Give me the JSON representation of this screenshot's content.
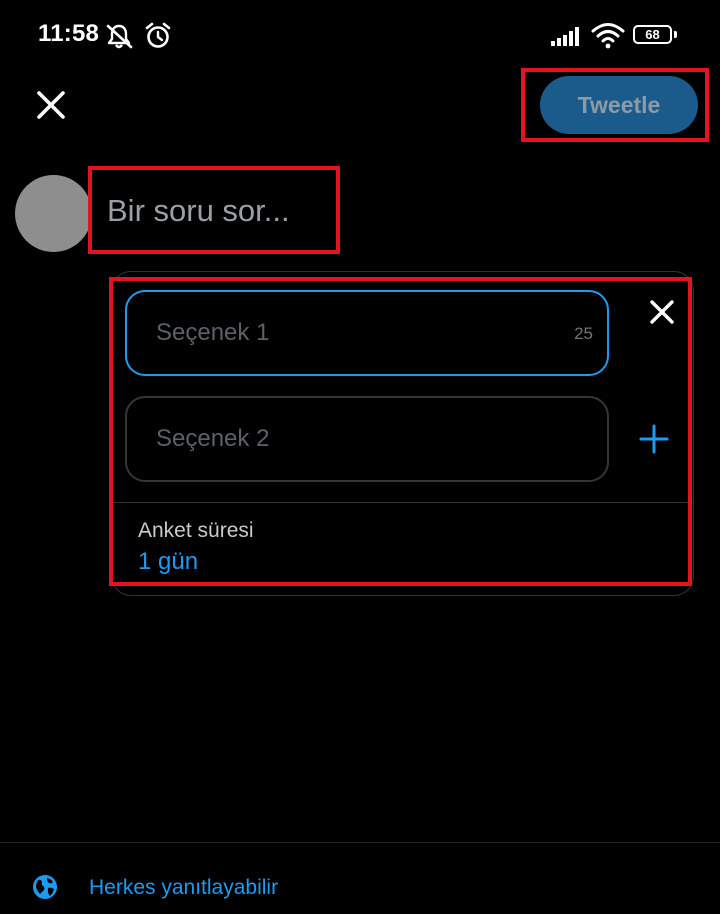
{
  "status_bar": {
    "time": "11:58",
    "battery": "68",
    "icons": [
      "mute-bell-icon",
      "alarm-clock-icon",
      "signal-icon",
      "wifi-icon",
      "battery-icon"
    ]
  },
  "header": {
    "close_icon": "close-icon",
    "tweet_button": "Tweetle"
  },
  "composer": {
    "question_placeholder": "Bir soru sor..."
  },
  "poll": {
    "choices": [
      {
        "placeholder": "Seçenek 1",
        "char_count": "25",
        "focused": true
      },
      {
        "placeholder": "Seçenek 2"
      }
    ],
    "remove_icon": "close-icon",
    "add_icon": "plus-icon",
    "length_label": "Anket süresi",
    "length_value": "1 gün"
  },
  "footer": {
    "reply_setting": "Herkes yanıtlayabilir",
    "reply_icon": "globe-icon"
  },
  "colors": {
    "background": "#000000",
    "accent": "#1d9bf0",
    "tweet_button_bg": "#1a5b8c",
    "highlight": "#e3141f",
    "border": "#2f3336"
  }
}
